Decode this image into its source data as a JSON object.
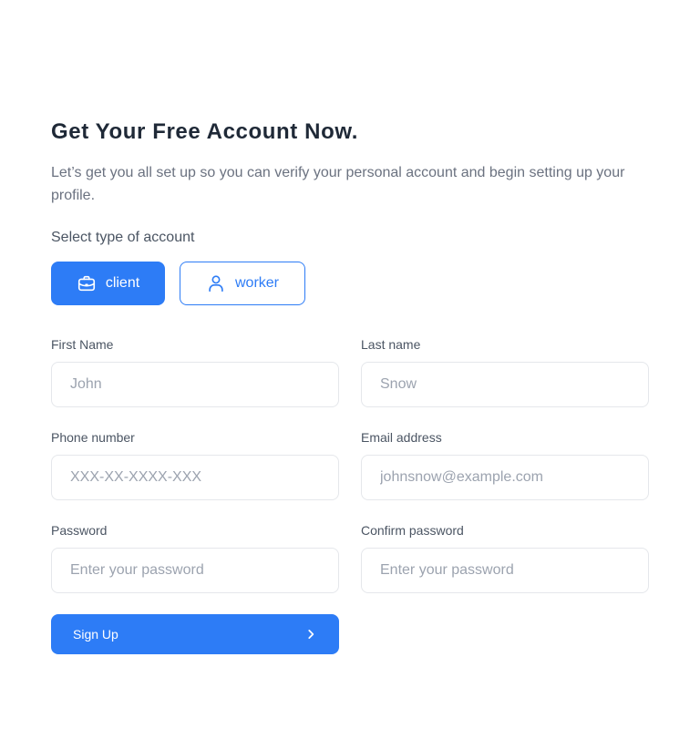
{
  "header": {
    "title": "Get Your Free Account Now.",
    "subtitle": "Let’s get you all set up so you can verify your personal account and begin setting up your profile."
  },
  "account_type": {
    "label": "Select type of account",
    "selected": "client",
    "options": [
      {
        "label": "client",
        "icon": "briefcase-icon"
      },
      {
        "label": "worker",
        "icon": "user-icon"
      }
    ]
  },
  "form": {
    "first_name": {
      "label": "First Name",
      "placeholder": "John",
      "value": ""
    },
    "last_name": {
      "label": "Last name",
      "placeholder": "Snow",
      "value": ""
    },
    "phone": {
      "label": "Phone number",
      "placeholder": "XXX-XX-XXXX-XXX",
      "value": ""
    },
    "email": {
      "label": "Email address",
      "placeholder": "johnsnow@example.com",
      "value": ""
    },
    "password": {
      "label": "Password",
      "placeholder": "Enter your password",
      "value": ""
    },
    "confirm_password": {
      "label": "Confirm password",
      "placeholder": "Enter your password",
      "value": ""
    }
  },
  "submit": {
    "label": "Sign Up",
    "icon": "chevron-right-icon"
  },
  "colors": {
    "accent": "#2d7cf6",
    "heading": "#1f2937",
    "muted_text": "#6b7280",
    "input_border": "#e5e7eb",
    "placeholder": "#9ca3af"
  }
}
